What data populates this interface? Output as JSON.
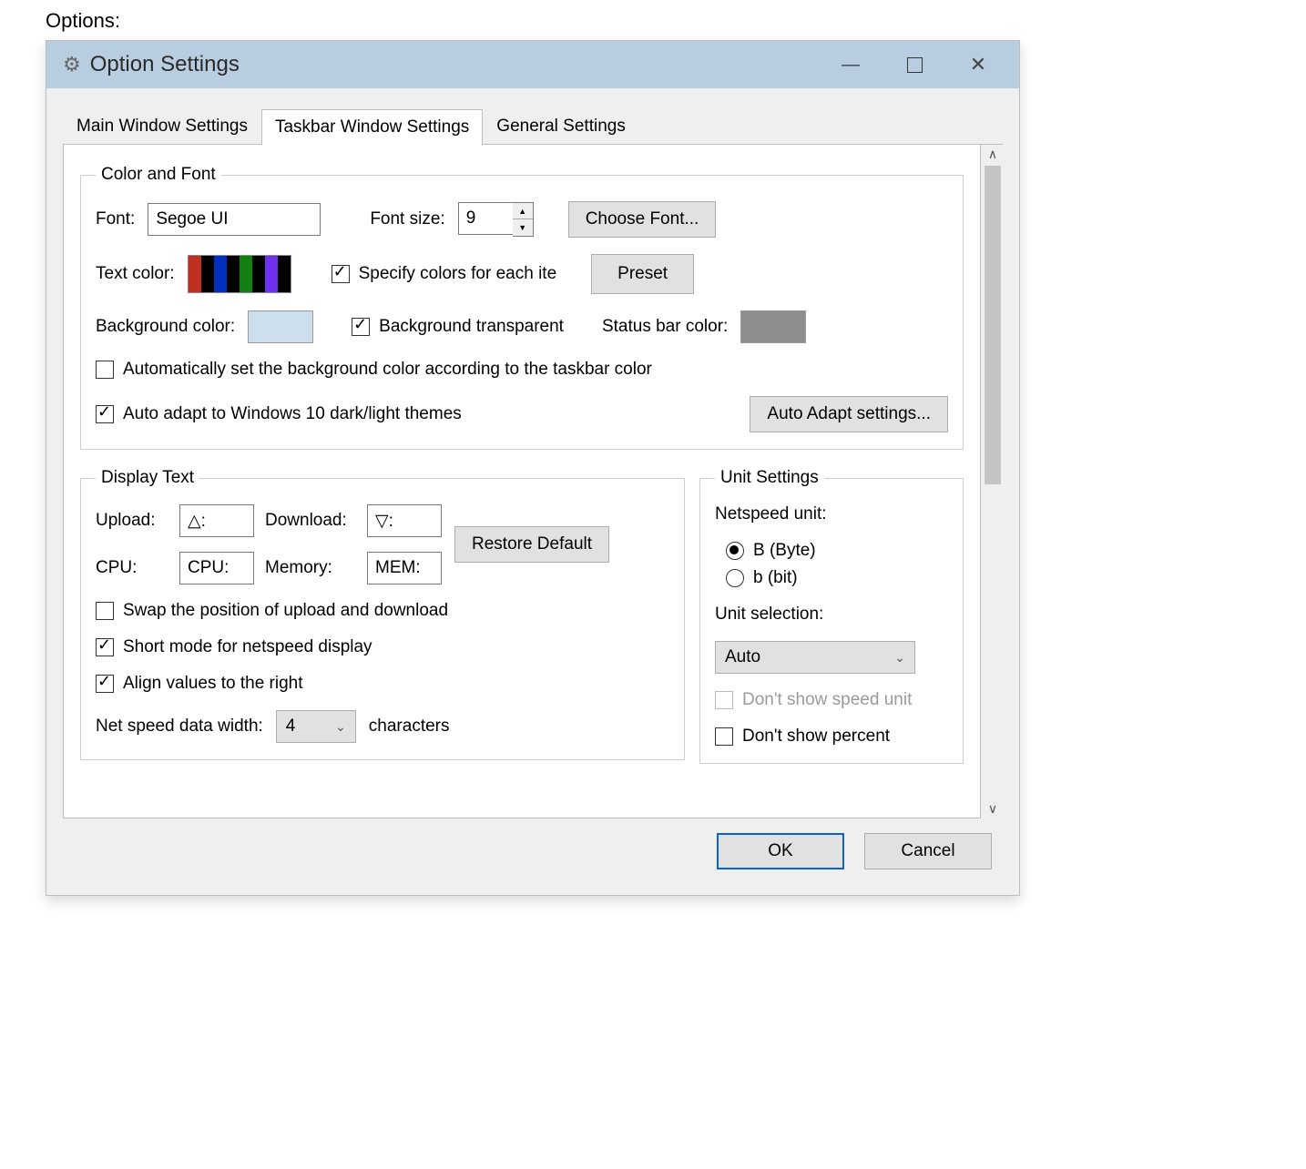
{
  "page_label": "Options:",
  "window": {
    "title": "Option Settings"
  },
  "tabs": {
    "items": [
      "Main Window Settings",
      "Taskbar Window Settings",
      "General Settings"
    ],
    "active_index": 1
  },
  "color_font": {
    "legend": "Color and Font",
    "font_label": "Font:",
    "font_value": "Segoe UI",
    "font_size_label": "Font size:",
    "font_size_value": "9",
    "choose_font_btn": "Choose Font...",
    "text_color_label": "Text color:",
    "swatch_colors": [
      "#c03020",
      "#000000",
      "#0030c0",
      "#000000",
      "#108010",
      "#000000",
      "#7030f0",
      "#000000"
    ],
    "specify_colors_label": "Specify colors for each ite",
    "specify_colors_checked": true,
    "preset_btn": "Preset",
    "bg_color_label": "Background color:",
    "bg_color_value": "#cddfed",
    "bg_transparent_label": "Background transparent",
    "bg_transparent_checked": true,
    "status_bar_color_label": "Status bar color:",
    "status_bar_color_value": "#8d8d8d",
    "auto_bg_label": "Automatically set the background color according to the taskbar color",
    "auto_bg_checked": false,
    "auto_adapt_label": "Auto adapt to Windows 10 dark/light themes",
    "auto_adapt_checked": true,
    "auto_adapt_btn": "Auto Adapt settings..."
  },
  "display_text": {
    "legend": "Display Text",
    "upload_label": "Upload:",
    "upload_value": "△:",
    "download_label": "Download:",
    "download_value": "▽:",
    "cpu_label": "CPU:",
    "cpu_value": "CPU:",
    "memory_label": "Memory:",
    "memory_value": "MEM:",
    "restore_default_btn": "Restore Default",
    "swap_label": "Swap the position of upload and download",
    "swap_checked": false,
    "short_mode_label": "Short mode for netspeed display",
    "short_mode_checked": true,
    "align_right_label": "Align values to the right",
    "align_right_checked": true,
    "net_width_label": "Net speed data width:",
    "net_width_value": "4",
    "net_width_suffix": "characters"
  },
  "unit_settings": {
    "legend": "Unit Settings",
    "netspeed_unit_label": "Netspeed unit:",
    "radio_byte_label": "B (Byte)",
    "radio_bit_label": "b (bit)",
    "radio_selected": "byte",
    "unit_selection_label": "Unit selection:",
    "unit_selection_value": "Auto",
    "dont_show_speed_label": "Don't show speed unit",
    "dont_show_speed_checked": false,
    "dont_show_percent_label": "Don't show percent",
    "dont_show_percent_checked": false
  },
  "dialog": {
    "ok": "OK",
    "cancel": "Cancel"
  }
}
